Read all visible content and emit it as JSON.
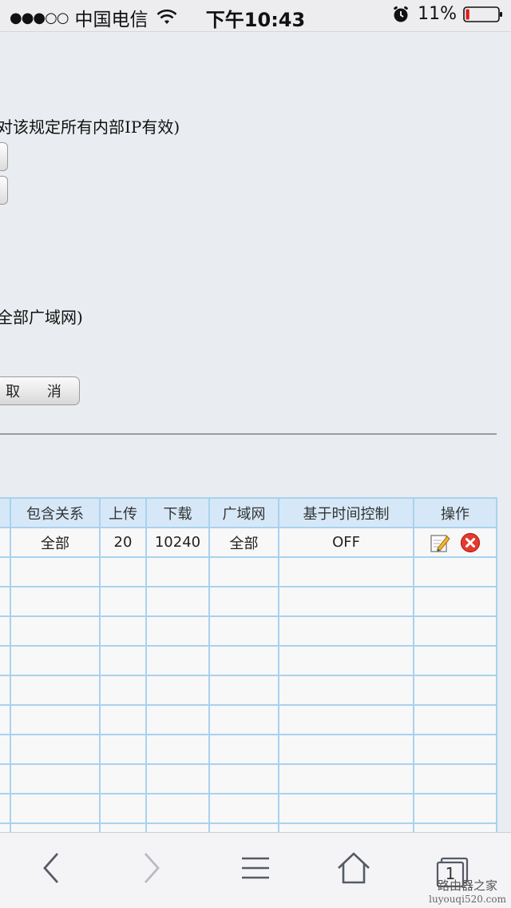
{
  "status_bar": {
    "signal_dots": "●●●○○",
    "carrier": "中国电信",
    "time": "下午10:43",
    "battery_percent": "11%",
    "battery_level": 0.11
  },
  "form": {
    "rule_hint": "对该规定所有内部IP有效)",
    "wan_hint": "全部广域网)",
    "cancel_label": "取 消"
  },
  "table": {
    "headers": [
      "包含关系",
      "上传",
      "下载",
      "广域网",
      "基于时间控制",
      "操作"
    ],
    "rows": [
      [
        "全部",
        "20",
        "10240",
        "全部",
        "OFF"
      ]
    ],
    "empty_rows": 10
  },
  "toolbar": {
    "tab_count": "1"
  },
  "watermark": {
    "line1": "路由器之家",
    "line2": "luyouqi520.com"
  }
}
